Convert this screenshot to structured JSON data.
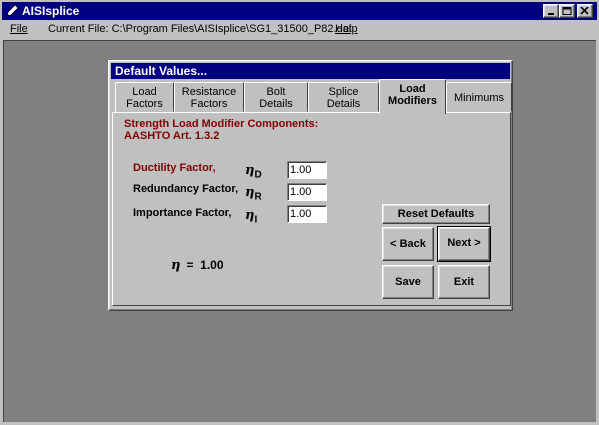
{
  "window": {
    "title": "AISIsplice",
    "minimize_icon": "minimize-icon",
    "maximize_icon": "maximize-icon",
    "close_icon": "close-icon"
  },
  "menu": {
    "file": "File",
    "current_file": "Current File:  C:\\Program Files\\AISIsplice\\SG1_31500_P82.dat",
    "help": "Help"
  },
  "dialog": {
    "title": "Default Values...",
    "tabs": [
      {
        "line1": "Load",
        "line2": "Factors"
      },
      {
        "line1": "Resistance",
        "line2": "Factors"
      },
      {
        "line1": "Bolt",
        "line2": "Details"
      },
      {
        "line1": "Splice",
        "line2": "Details"
      },
      {
        "line1": "Load",
        "line2": "Modifiers"
      },
      {
        "line1": "Minimums",
        "line2": ""
      }
    ],
    "active_tab": "Load Modifiers",
    "section_title_line1": "Strength Load Modifier Components:",
    "section_title_line2": "AASHTO Art. 1.3.2",
    "factors": {
      "ductility": {
        "label": "Ductility Factor,",
        "symbol": "η",
        "subscript": "D",
        "value": "1.00"
      },
      "redundancy": {
        "label": "Redundancy Factor,",
        "symbol": "η",
        "subscript": "R",
        "value": "1.00"
      },
      "importance": {
        "label": "Importance Factor,",
        "symbol": "η",
        "subscript": "I",
        "value": "1.00"
      }
    },
    "eta_total": {
      "symbol": "η",
      "equals": "=",
      "value": "1.00"
    },
    "buttons": {
      "reset_defaults": "Reset Defaults",
      "back": "< Back",
      "next": "Next >",
      "save": "Save",
      "exit": "Exit"
    }
  }
}
